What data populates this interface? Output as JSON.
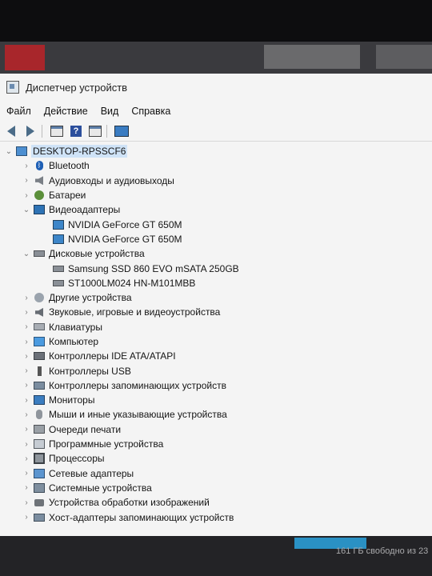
{
  "window": {
    "title": "Диспетчер устройств"
  },
  "menu": {
    "items": [
      "Файл",
      "Действие",
      "Вид",
      "Справка"
    ]
  },
  "toolbar": {
    "buttons": [
      "back-arrow-icon",
      "forward-arrow-icon",
      "properties-icon",
      "help-icon",
      "update-driver-icon",
      "scan-hardware-icon"
    ]
  },
  "tree": {
    "root": "DESKTOP-RPSSCF6",
    "bluetooth": "Bluetooth",
    "audio_io": "Аудиовходы и аудиовыходы",
    "batteries": "Батареи",
    "video_adapters": "Видеоадаптеры",
    "gpu1": "NVIDIA GeForce GT 650M",
    "gpu2": "NVIDIA GeForce GT 650M",
    "disk_devices": "Дисковые устройства",
    "disk1": "Samsung SSD 860 EVO mSATA 250GB",
    "disk2": "ST1000LM024 HN-M101MBB",
    "other_devices": "Другие устройства",
    "sound_devices": "Звуковые, игровые и видеоустройства",
    "keyboards": "Клавиатуры",
    "computer": "Компьютер",
    "ide": "Контроллеры IDE ATA/ATAPI",
    "usb": "Контроллеры USB",
    "storage_controllers": "Контроллеры запоминающих устройств",
    "monitors": "Мониторы",
    "mice": "Мыши и иные указывающие устройства",
    "print_queues": "Очереди печати",
    "software_devices": "Программные устройства",
    "processors": "Процессоры",
    "network_adapters": "Сетевые адаптеры",
    "system_devices": "Системные устройства",
    "imaging_devices": "Устройства обработки изображений",
    "storage_host": "Хост-адаптеры запоминающих устройств"
  },
  "taskbar": {
    "free_space": "161 ГБ свободно из 23"
  },
  "colors": {
    "selection": "#cfe3f7",
    "window_bg": "#f4f4f4",
    "accent": "#2e73b5"
  }
}
